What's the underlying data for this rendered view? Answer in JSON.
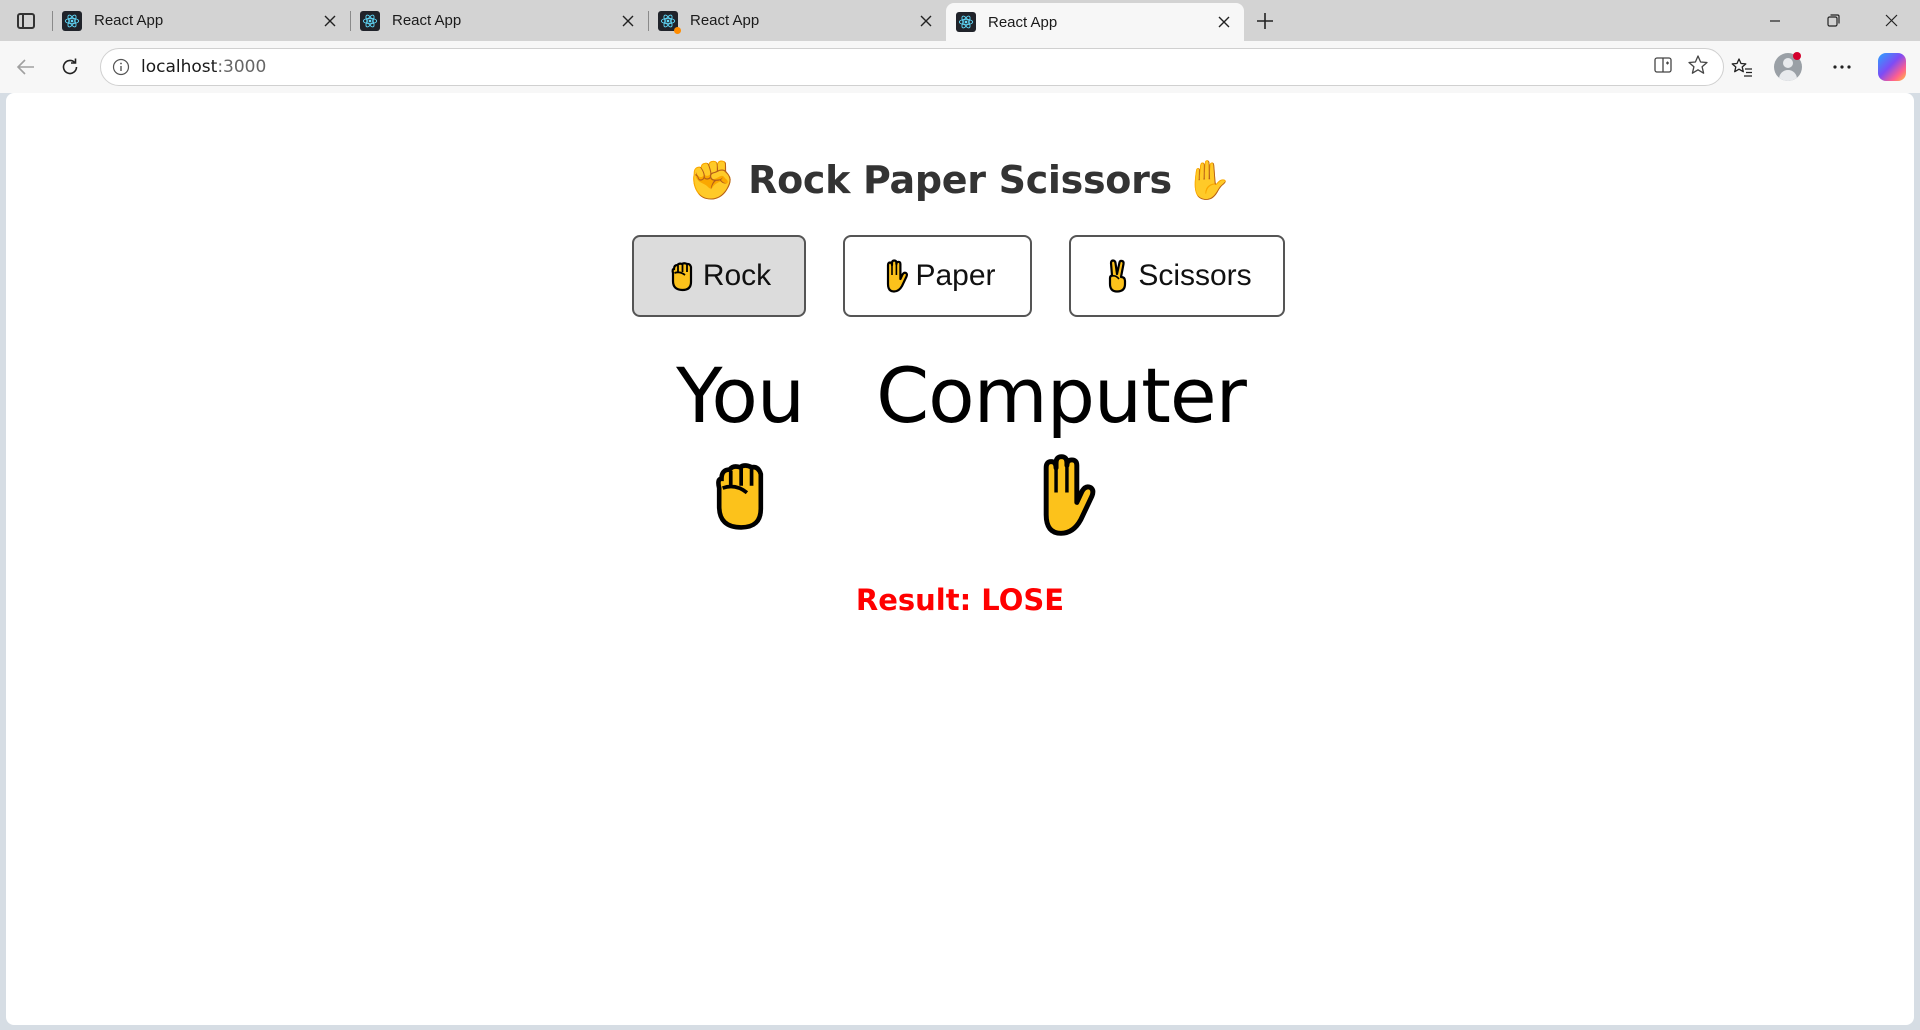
{
  "browser": {
    "tabs": [
      {
        "title": "React App",
        "active": false,
        "has_badge": false
      },
      {
        "title": "React App",
        "active": false,
        "has_badge": false
      },
      {
        "title": "React App",
        "active": false,
        "has_badge": true
      },
      {
        "title": "React App",
        "active": true,
        "has_badge": false
      }
    ],
    "address": {
      "host": "localhost",
      "port": ":3000"
    },
    "icons": {
      "tab_actions": "vertical-tabs-icon",
      "new_tab": "plus-icon",
      "back": "back-arrow-icon",
      "reload": "reload-icon",
      "site_info": "info-icon",
      "split_screen": "split-screen-icon",
      "favorite": "star-icon",
      "favorites_bar": "favorites-icon",
      "profile": "avatar-icon",
      "more": "ellipsis-icon",
      "copilot": "copilot-icon"
    },
    "accent_colors": {
      "profile_badge": "#d4002c",
      "tab_badge": "#ff8c00"
    }
  },
  "app": {
    "title_prefix_emoji": "✊",
    "title_text": "Rock Paper Scissors",
    "title_suffix_emoji": "✋",
    "choices": [
      {
        "label": "Rock",
        "icon": "fist-icon",
        "selected": true
      },
      {
        "label": "Paper",
        "icon": "raised-hand-icon",
        "selected": false
      },
      {
        "label": "Scissors",
        "icon": "victory-hand-icon",
        "selected": false
      }
    ],
    "players": [
      {
        "label": "You",
        "hand": "fist-icon"
      },
      {
        "label": "Computer",
        "hand": "raised-hand-icon"
      }
    ],
    "result_text": "Result: LOSE",
    "result_color": "#ff0000"
  }
}
